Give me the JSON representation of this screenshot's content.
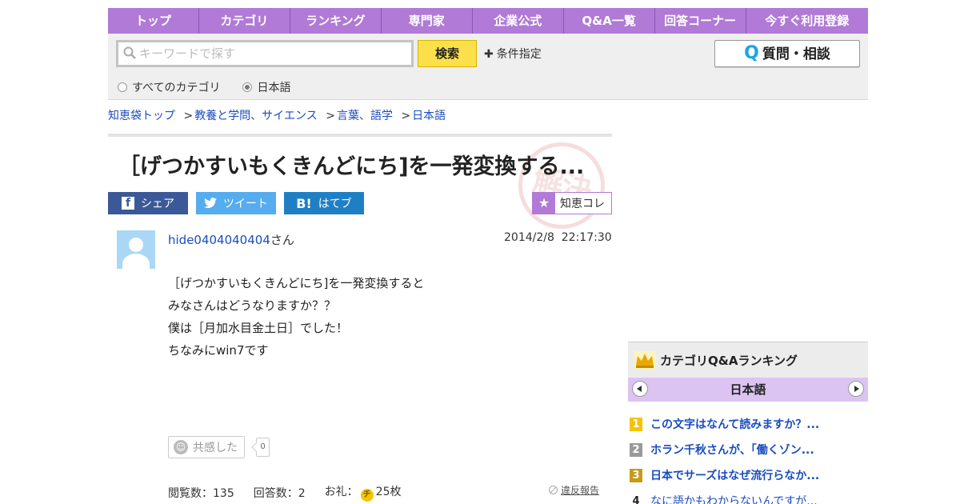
{
  "nav": {
    "items": [
      "トップ",
      "カテゴリ",
      "ランキング",
      "専門家",
      "企業公式",
      "Q&A一覧",
      "回答コーナー",
      "今すぐ利用登録"
    ]
  },
  "search": {
    "placeholder": "キーワードで探す",
    "button_label": "検索",
    "condition_label": "条件指定",
    "ask_button_label": "質問・相談",
    "ask_button_icon": "Q",
    "scope_all_label": "すべてのカテゴリ",
    "scope_category_label": "日本語",
    "selected_scope": "日本語"
  },
  "breadcrumb": {
    "items": [
      "知恵袋トップ",
      "教養と学問、サイエンス",
      "言葉、語学",
      "日本語"
    ],
    "separator": ">"
  },
  "question": {
    "title": "［げつかすいもくきんどにち]を一発変換する...",
    "stamp_text": "解決済",
    "user": "hide0404040404",
    "user_suffix": "さん",
    "datetime": "2014/2/8  22:17:30",
    "body_lines": [
      "［げつかすいもくきんどにち]を一発変換すると",
      "",
      "みなさんはどうなりますか？？",
      "僕は［月加水目金土日］でした！",
      "",
      "ちなみにwin7です"
    ],
    "empathy_label": "共感した",
    "empathy_count": "0",
    "views_label": "閲覧数：135",
    "answers_label": "回答数：2",
    "reward_prefix": "お礼：",
    "reward_coin_symbol": "チ",
    "reward_value": "25枚",
    "report_label": "違反報告"
  },
  "share": {
    "facebook_label": "シェア",
    "twitter_label": "ツイート",
    "hatena_label": "はてブ",
    "hatena_icon": "B!",
    "collect_label": "知恵コレ"
  },
  "ranking": {
    "title": "カテゴリQ&Aランキング",
    "category": "日本語",
    "items": [
      {
        "rank": "1",
        "text": "この文字はなんて読みますか？...",
        "color": "#f5c400"
      },
      {
        "rank": "2",
        "text": "ホラン千秋さんが、「働くゾン...",
        "color": "#9a9a9a"
      },
      {
        "rank": "3",
        "text": "日本でサーズはなぜ流行らなか...",
        "color": "#c79a1a"
      },
      {
        "rank": "4",
        "text": "なに語かもわからないんですが...",
        "color": ""
      }
    ]
  },
  "colors": {
    "nav_bg": "#b07ad6",
    "link": "#1a4dbf",
    "search_button": "#fce04a",
    "facebook": "#3b5998",
    "twitter": "#55acee",
    "hatena": "#1f7fc4"
  }
}
